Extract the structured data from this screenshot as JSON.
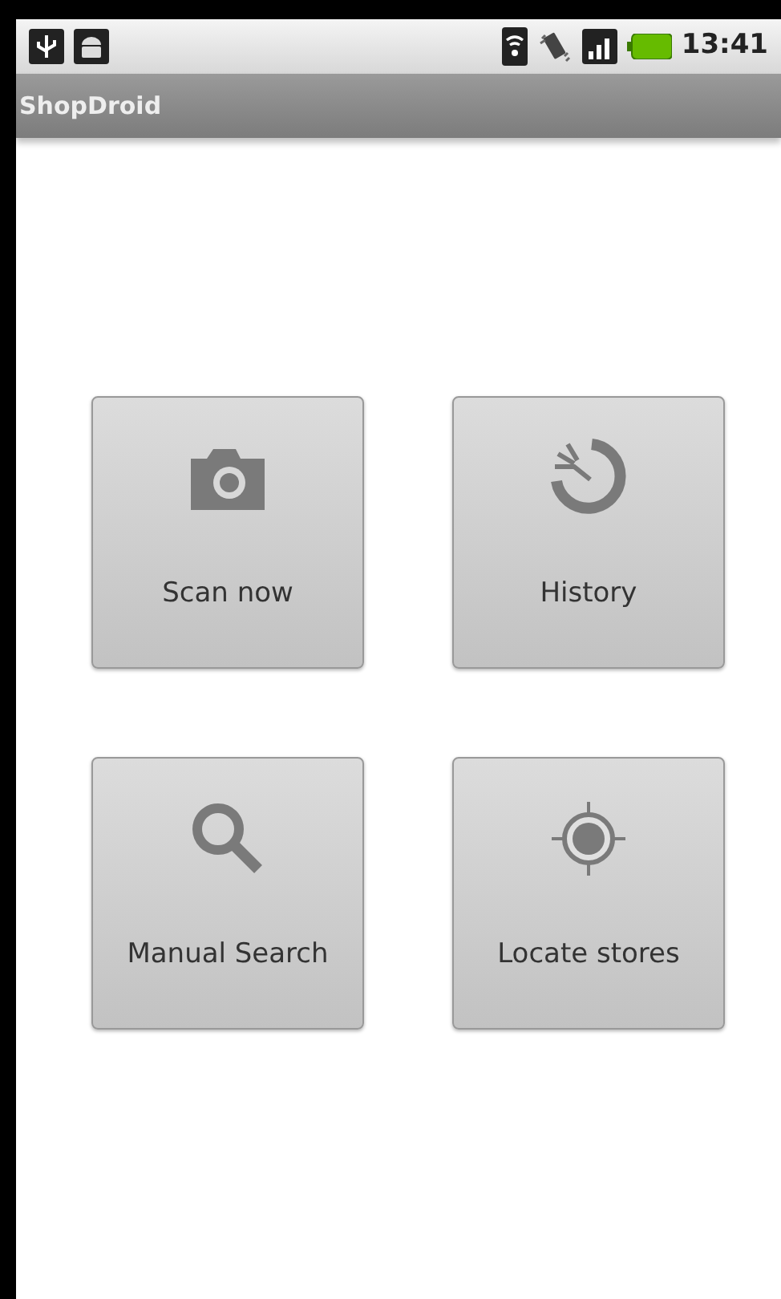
{
  "status_bar": {
    "time": "13:41"
  },
  "title_bar": {
    "title": "ShopDroid"
  },
  "buttons": [
    {
      "label": "Scan now"
    },
    {
      "label": "History"
    },
    {
      "label": "Manual Search"
    },
    {
      "label": "Locate stores"
    }
  ]
}
